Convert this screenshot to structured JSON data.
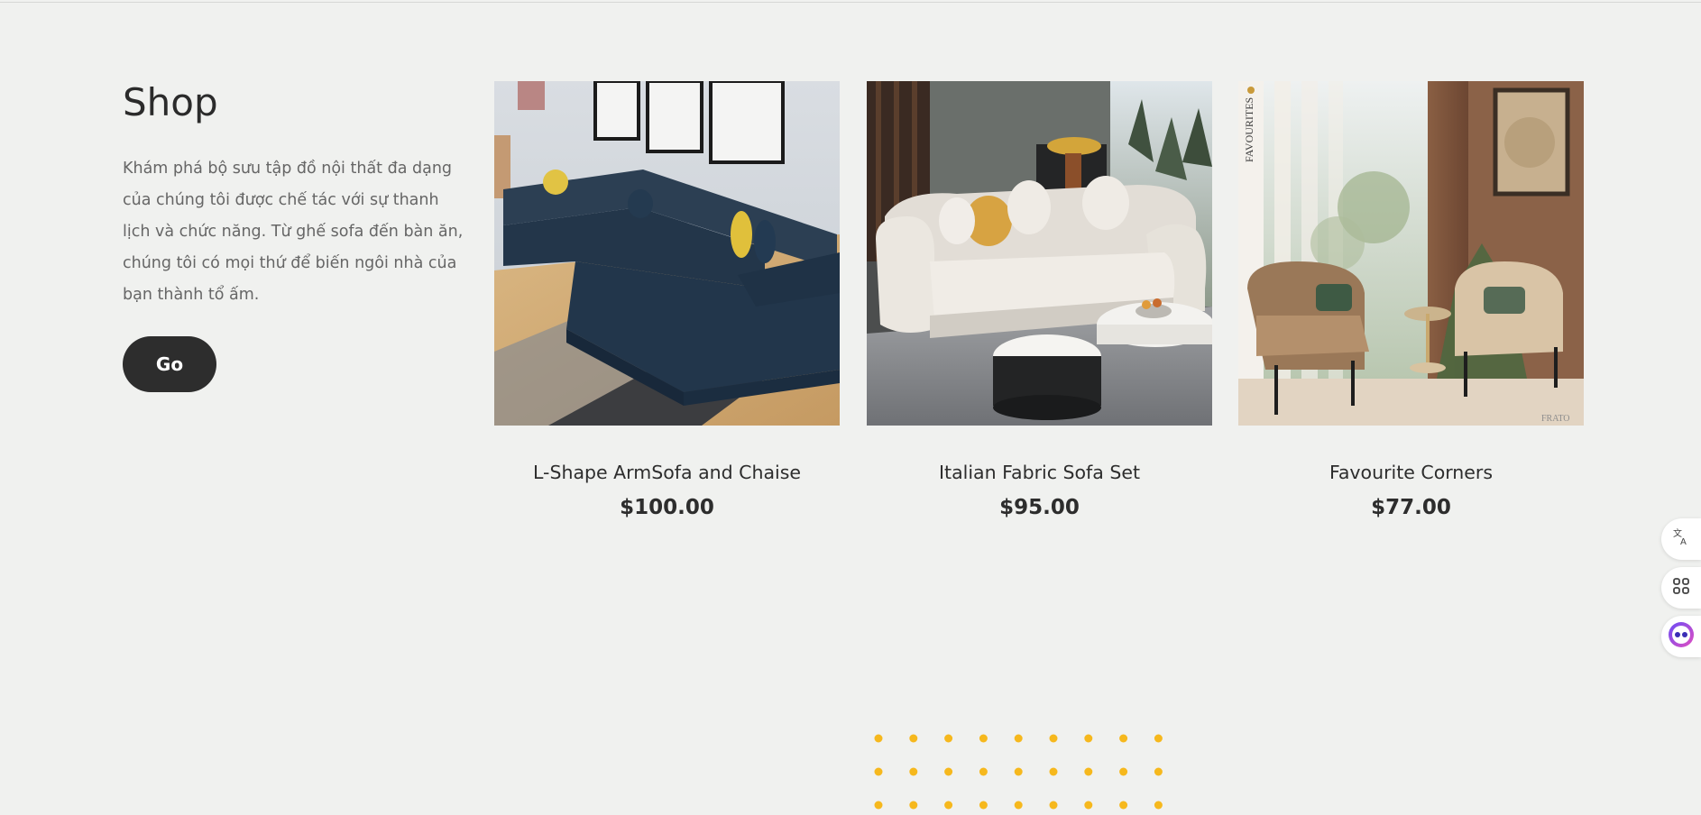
{
  "shop": {
    "title": "Shop",
    "description": "Khám phá bộ sưu tập đồ nội thất đa dạng của chúng tôi được chế tác với sự thanh lịch và chức năng. Từ ghế sofa đến bàn ăn, chúng tôi có mọi thứ để biến ngôi nhà của bạn thành tổ ấm.",
    "button_label": "Go"
  },
  "products": [
    {
      "name": "L-Shape ArmSofa and Chaise",
      "price": "$100.00",
      "image": "navy-l-shape-sofa-photo"
    },
    {
      "name": "Italian Fabric Sofa Set",
      "price": "$95.00",
      "image": "white-fabric-sofa-photo"
    },
    {
      "name": "Favourite Corners",
      "price": "$77.00",
      "image": "armchairs-corner-photo",
      "image_text": {
        "vertical": "FAVOURITES",
        "corner": "FRATO"
      }
    }
  ],
  "side_tools": [
    {
      "icon": "translate-icon"
    },
    {
      "icon": "apps-grid-icon"
    },
    {
      "icon": "assistant-bot-icon"
    }
  ],
  "colors": {
    "background": "#f0f1ef",
    "button": "#2d2d2d",
    "dot_accent": "#f6b81d"
  }
}
